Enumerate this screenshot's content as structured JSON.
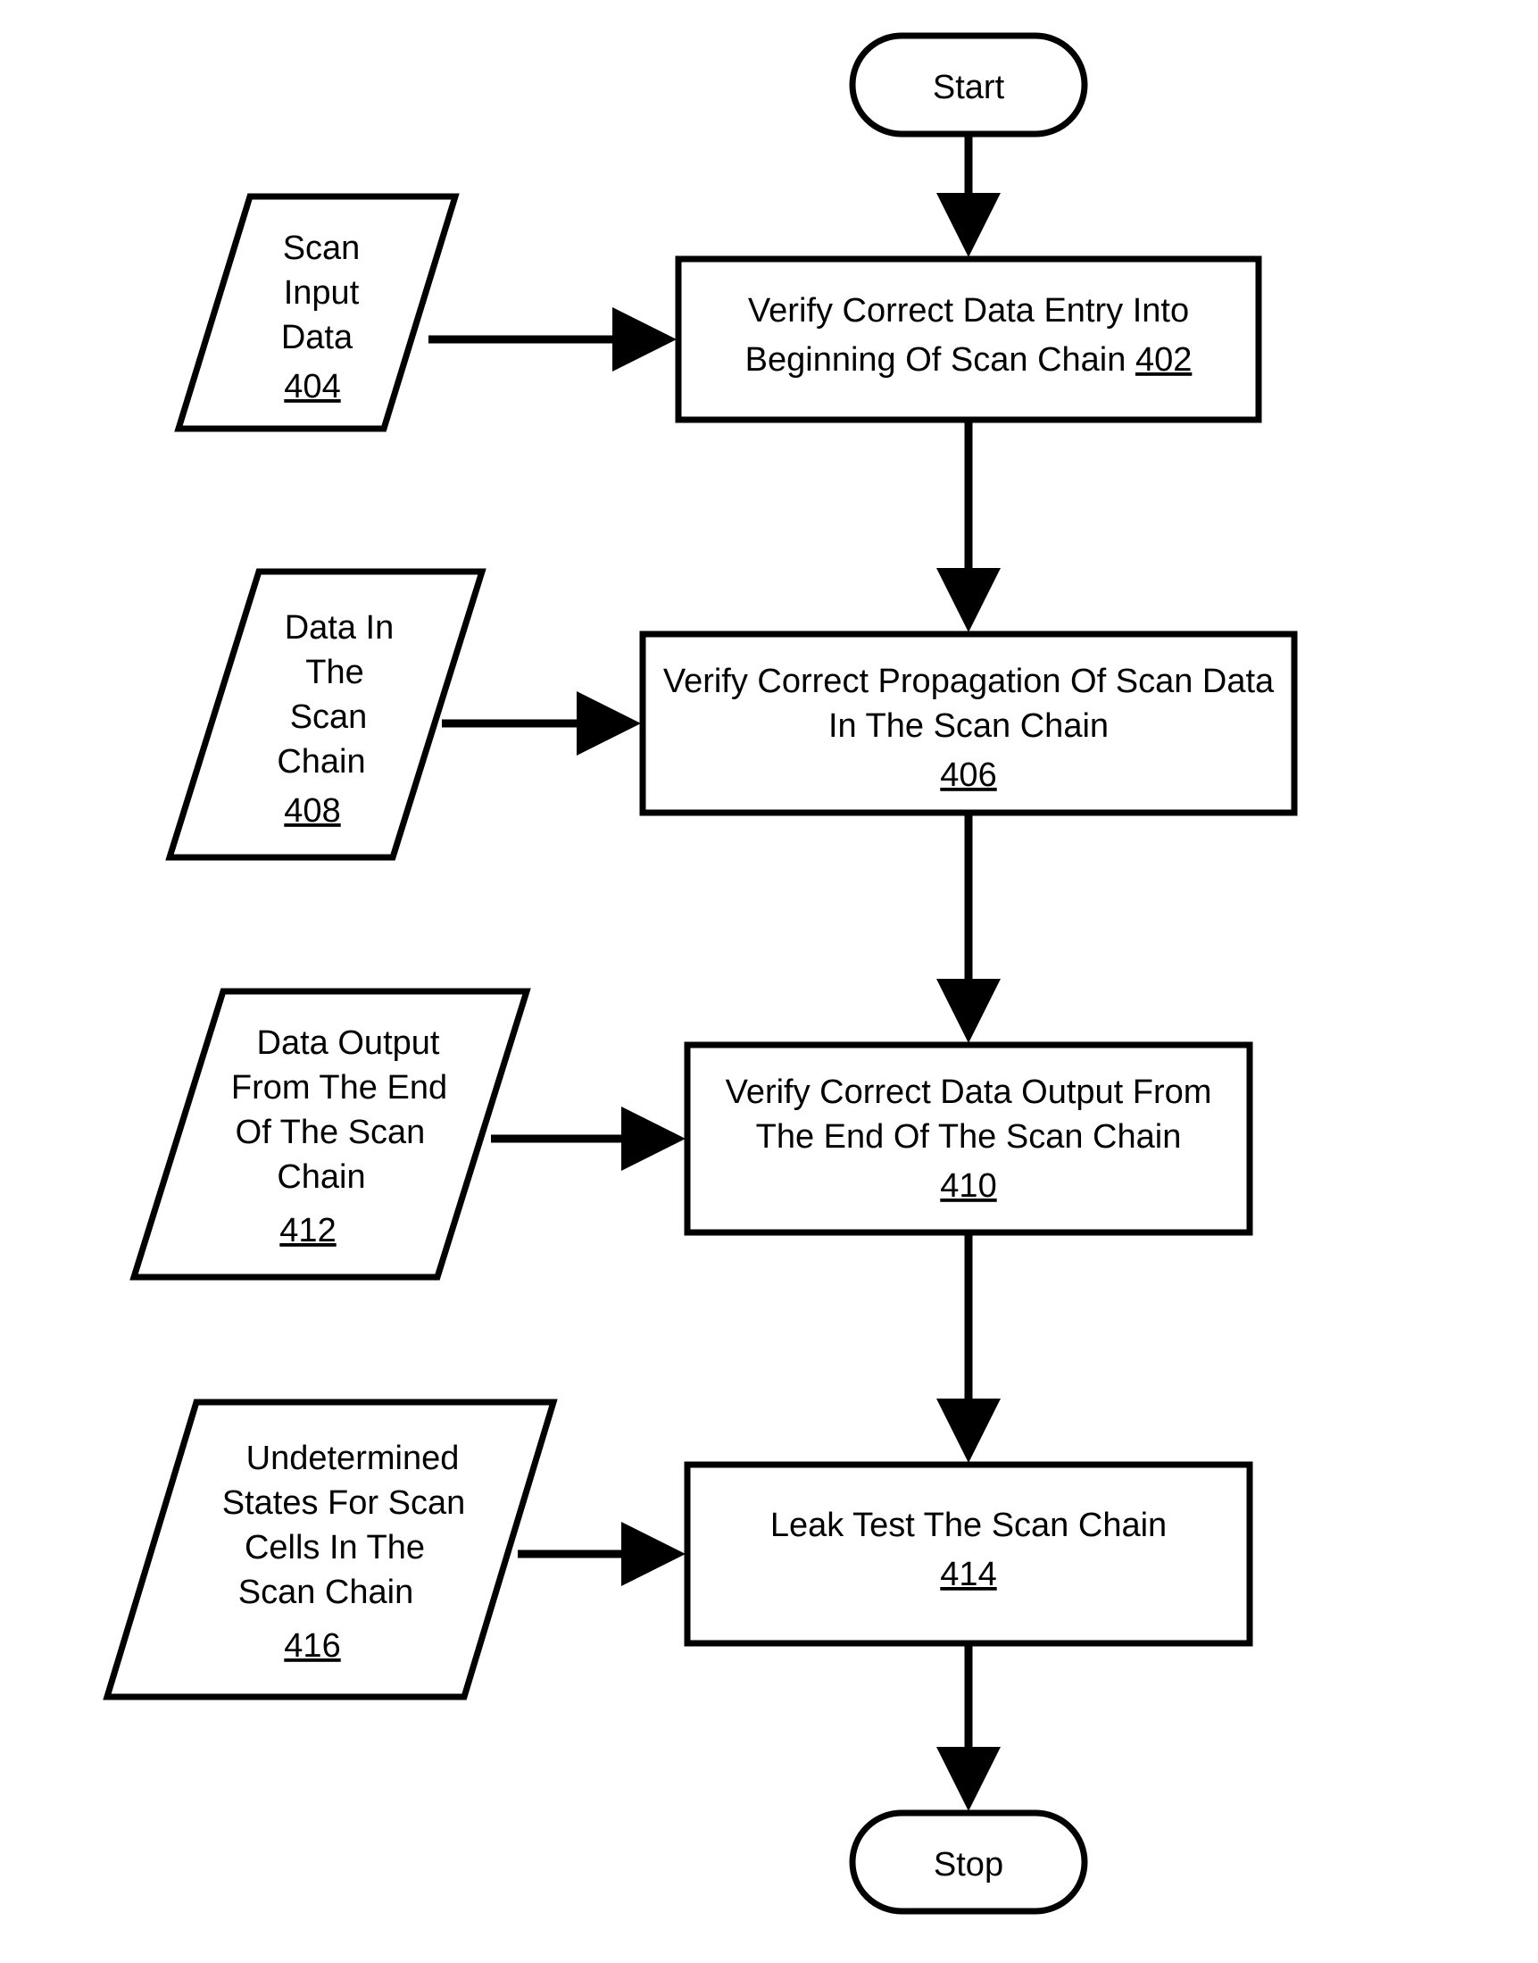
{
  "terminals": {
    "start": "Start",
    "stop": "Stop"
  },
  "process": {
    "p1": {
      "l1": "Verify Correct Data Entry Into",
      "l2": "Beginning Of Scan Chain",
      "ref": "402"
    },
    "p2": {
      "l1": "Verify Correct Propagation Of Scan Data",
      "l2": "In The Scan Chain",
      "ref": "406"
    },
    "p3": {
      "l1": "Verify Correct Data Output From",
      "l2": "The End Of The Scan Chain",
      "ref": "410"
    },
    "p4": {
      "l1": "Leak Test The Scan Chain",
      "ref": "414"
    }
  },
  "data": {
    "d1": {
      "l1": "Scan",
      "l2": "Input",
      "l3": "Data",
      "ref": "404"
    },
    "d2": {
      "l1": "Data In",
      "l2": "The",
      "l3": "Scan",
      "l4": "Chain",
      "ref": "408"
    },
    "d3": {
      "l1": "Data Output",
      "l2": "From The End",
      "l3": "Of The Scan",
      "l4": "Chain",
      "ref": "412"
    },
    "d4": {
      "l1": "Undetermined",
      "l2": "States For Scan",
      "l3": "Cells In The",
      "l4": "Scan Chain",
      "ref": "416"
    }
  }
}
